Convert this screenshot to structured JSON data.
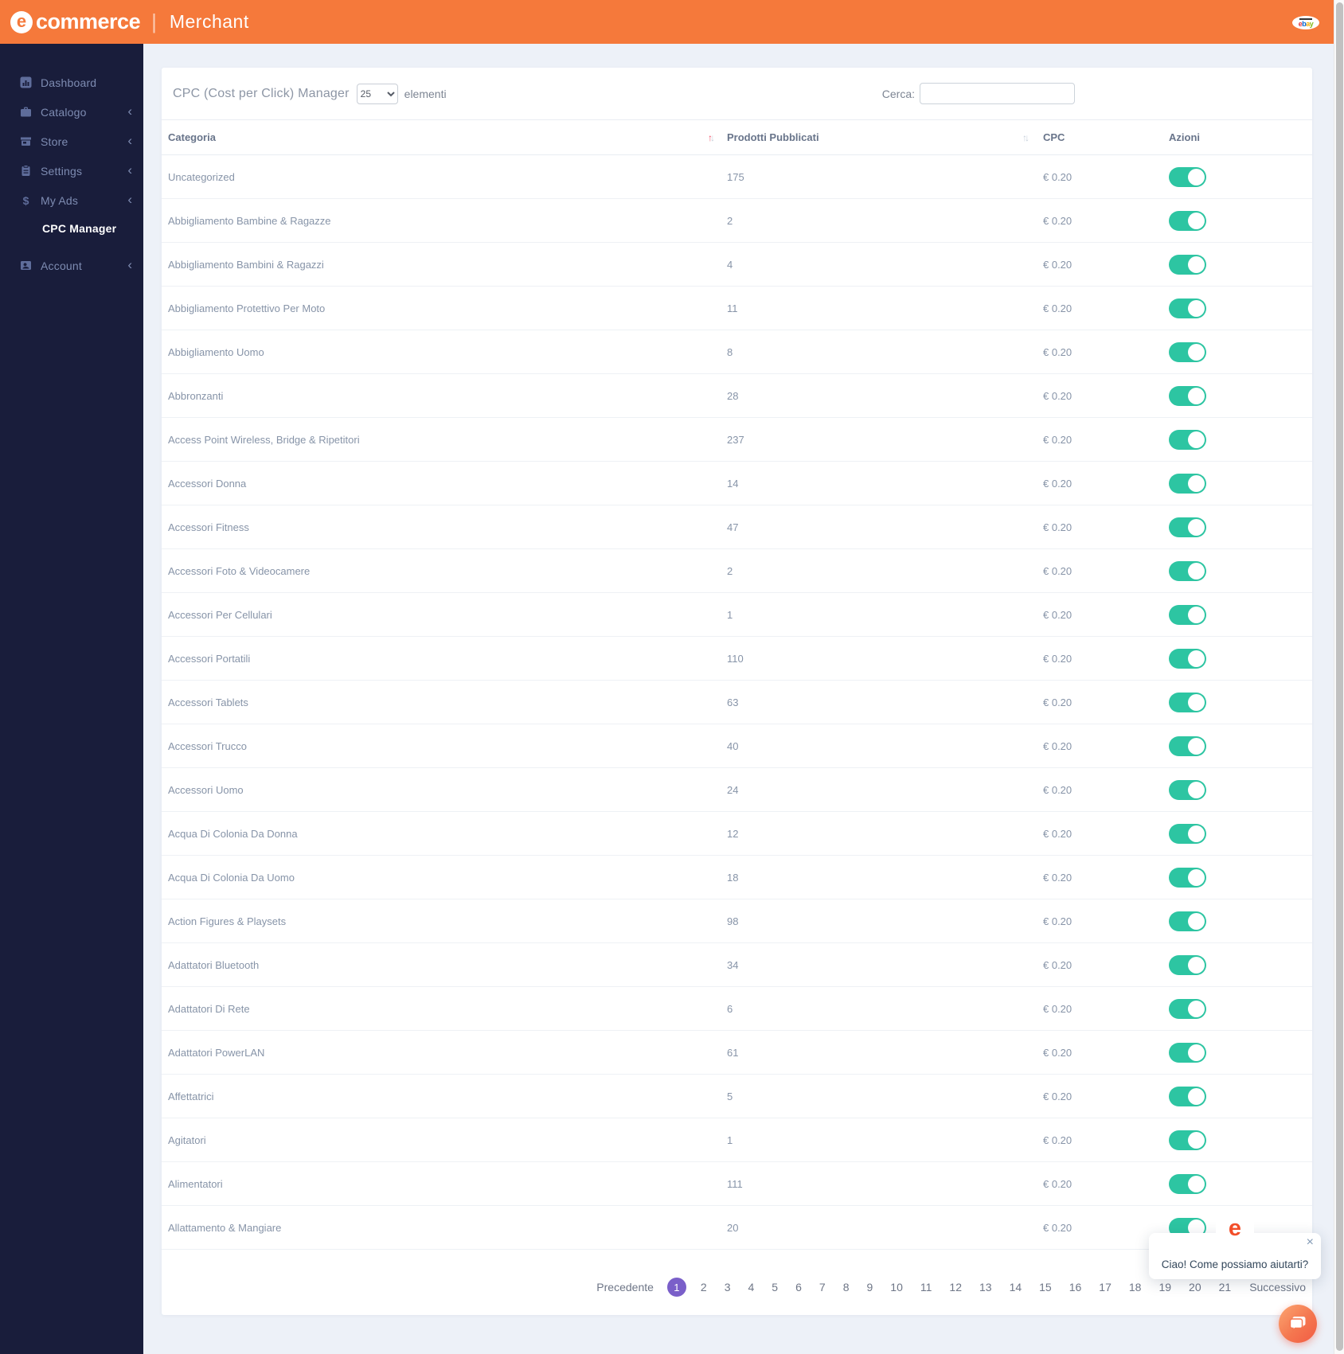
{
  "header": {
    "brand_e": "e",
    "brand_word": "commerce",
    "divider": "|",
    "app_name": "Merchant",
    "badge_letters": [
      "e",
      "b",
      "a",
      "y"
    ]
  },
  "sidebar": {
    "chevron": "‹",
    "items": [
      {
        "label": "Dashboard",
        "icon": "bar-chart-icon"
      },
      {
        "label": "Catalogo",
        "icon": "briefcase-icon"
      },
      {
        "label": "Store",
        "icon": "storefront-icon"
      },
      {
        "label": "Settings",
        "icon": "clipboard-icon"
      },
      {
        "label": "My Ads",
        "icon": "dollar-icon"
      },
      {
        "label": "CPC Manager",
        "icon": null,
        "active": true,
        "submenu": true
      },
      {
        "label": "Account",
        "icon": "id-card-icon"
      }
    ]
  },
  "controls": {
    "title": "CPC (Cost per Click) Manager",
    "page_size": "25",
    "page_size_suffix": "elementi",
    "search_label": "Cerca:",
    "search_value": ""
  },
  "icons": {
    "sort_up": "↑",
    "sort_down": "↓",
    "close": "×"
  },
  "table": {
    "columns": [
      "Categoria",
      "Prodotti Pubblicati",
      "CPC",
      "Azioni"
    ],
    "rows": [
      {
        "category": "Uncategorized",
        "products": "175",
        "cpc": "€ 0.20",
        "enabled": true
      },
      {
        "category": "Abbigliamento Bambine & Ragazze",
        "products": "2",
        "cpc": "€ 0.20",
        "enabled": true
      },
      {
        "category": "Abbigliamento Bambini & Ragazzi",
        "products": "4",
        "cpc": "€ 0.20",
        "enabled": true
      },
      {
        "category": "Abbigliamento Protettivo Per Moto",
        "products": "11",
        "cpc": "€ 0.20",
        "enabled": true
      },
      {
        "category": "Abbigliamento Uomo",
        "products": "8",
        "cpc": "€ 0.20",
        "enabled": true
      },
      {
        "category": "Abbronzanti",
        "products": "28",
        "cpc": "€ 0.20",
        "enabled": true
      },
      {
        "category": "Access Point Wireless, Bridge & Ripetitori",
        "products": "237",
        "cpc": "€ 0.20",
        "enabled": true
      },
      {
        "category": "Accessori Donna",
        "products": "14",
        "cpc": "€ 0.20",
        "enabled": true
      },
      {
        "category": "Accessori Fitness",
        "products": "47",
        "cpc": "€ 0.20",
        "enabled": true
      },
      {
        "category": "Accessori Foto & Videocamere",
        "products": "2",
        "cpc": "€ 0.20",
        "enabled": true
      },
      {
        "category": "Accessori Per Cellulari",
        "products": "1",
        "cpc": "€ 0.20",
        "enabled": true
      },
      {
        "category": "Accessori Portatili",
        "products": "110",
        "cpc": "€ 0.20",
        "enabled": true
      },
      {
        "category": "Accessori Tablets",
        "products": "63",
        "cpc": "€ 0.20",
        "enabled": true
      },
      {
        "category": "Accessori Trucco",
        "products": "40",
        "cpc": "€ 0.20",
        "enabled": true
      },
      {
        "category": "Accessori Uomo",
        "products": "24",
        "cpc": "€ 0.20",
        "enabled": true
      },
      {
        "category": "Acqua Di Colonia Da Donna",
        "products": "12",
        "cpc": "€ 0.20",
        "enabled": true
      },
      {
        "category": "Acqua Di Colonia Da Uomo",
        "products": "18",
        "cpc": "€ 0.20",
        "enabled": true
      },
      {
        "category": "Action Figures & Playsets",
        "products": "98",
        "cpc": "€ 0.20",
        "enabled": true
      },
      {
        "category": "Adattatori Bluetooth",
        "products": "34",
        "cpc": "€ 0.20",
        "enabled": true
      },
      {
        "category": "Adattatori Di Rete",
        "products": "6",
        "cpc": "€ 0.20",
        "enabled": true
      },
      {
        "category": "Adattatori PowerLAN",
        "products": "61",
        "cpc": "€ 0.20",
        "enabled": true
      },
      {
        "category": "Affettatrici",
        "products": "5",
        "cpc": "€ 0.20",
        "enabled": true
      },
      {
        "category": "Agitatori",
        "products": "1",
        "cpc": "€ 0.20",
        "enabled": true
      },
      {
        "category": "Alimentatori",
        "products": "111",
        "cpc": "€ 0.20",
        "enabled": true
      },
      {
        "category": "Allattamento & Mangiare",
        "products": "20",
        "cpc": "€ 0.20",
        "enabled": true
      }
    ]
  },
  "pagination": {
    "previous": "Precedente",
    "pages": [
      "1",
      "2",
      "3",
      "4",
      "5",
      "6",
      "7",
      "8",
      "9",
      "10",
      "11",
      "12",
      "13",
      "14",
      "15",
      "16",
      "17",
      "18",
      "19",
      "20",
      "21"
    ],
    "active_page": "1",
    "next": "Successivo"
  },
  "chat": {
    "popup_text": "Ciao! Come possiamo aiutarti?",
    "avatar_letter": "e"
  },
  "colors": {
    "header_orange": "#f5793b",
    "sidebar_navy": "#191d3b",
    "toggle_green": "#2dc5a2",
    "sort_active_red": "#f1556c",
    "pagination_active_purple": "#7a5fc9",
    "chat_logo_red": "#f24e29"
  }
}
